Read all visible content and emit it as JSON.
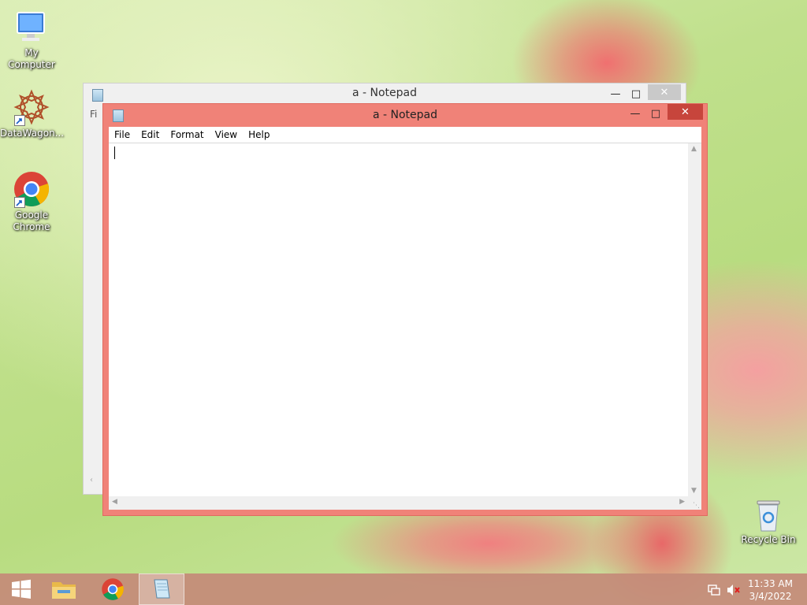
{
  "desktop": {
    "icons": [
      {
        "label": "My Computer",
        "icon": "computer-icon"
      },
      {
        "label": "DataWagon...",
        "icon": "datawagon-icon"
      },
      {
        "label": "Google Chrome",
        "icon": "chrome-icon"
      },
      {
        "label": "Recycle Bin",
        "icon": "recycle-bin-icon"
      }
    ]
  },
  "background_window": {
    "title": "a - Notepad",
    "menu_partial": "Fi"
  },
  "notepad": {
    "title": "a - Notepad",
    "menu": [
      "File",
      "Edit",
      "Format",
      "View",
      "Help"
    ],
    "content": "",
    "accent_color": "#f08278"
  },
  "taskbar": {
    "pinned": [
      "windows-start-icon",
      "file-explorer-icon",
      "chrome-icon",
      "notepad-icon"
    ],
    "time": "11:33 AM",
    "date": "3/4/2022"
  }
}
